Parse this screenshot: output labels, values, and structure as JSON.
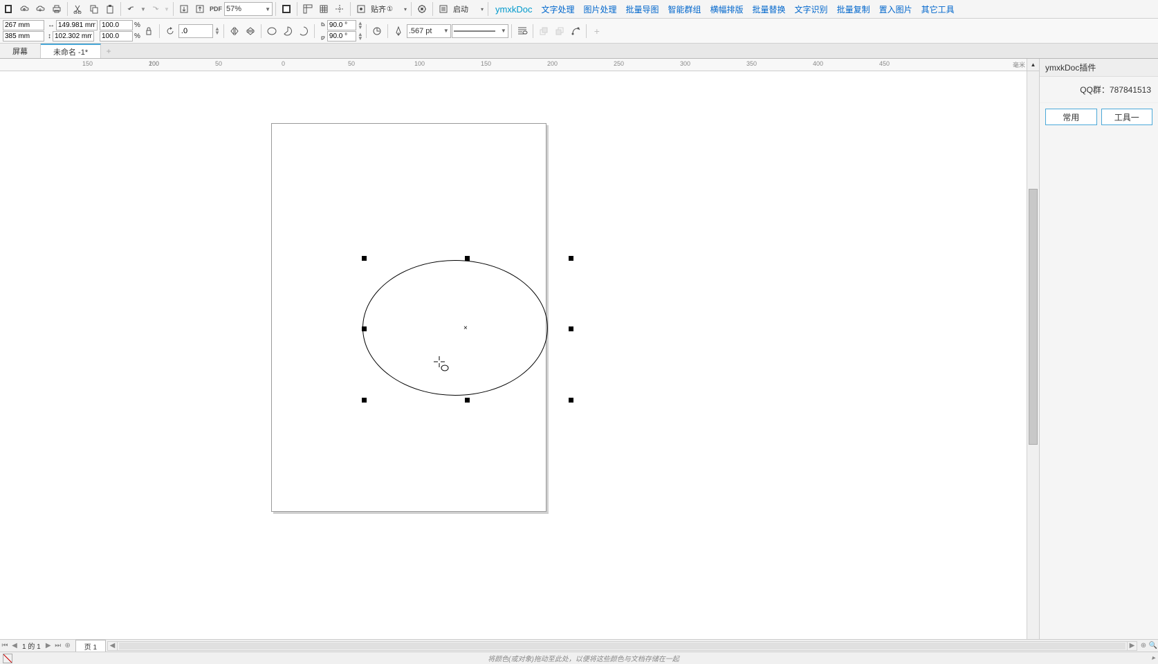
{
  "toolbar1": {
    "zoom": "57%",
    "snap_label": "贴齐",
    "snap_suffix": "①",
    "launch_label": "启动"
  },
  "menus": {
    "brand": "ymxkDoc",
    "items": [
      "文字处理",
      "图片处理",
      "批量导图",
      "智能群组",
      "横幅排版",
      "批量替换",
      "文字识别",
      "批量复制",
      "置入图片",
      "其它工具"
    ]
  },
  "props": {
    "x": "267 mm",
    "y": "385 mm",
    "w": "149.981 mm",
    "h": "102.302 mm",
    "sx": "100.0",
    "sy": "100.0",
    "pct": "%",
    "rot": ".0",
    "arc1": "90.0 °",
    "arc2": "90.0 °",
    "outline": ".567 pt"
  },
  "tabs": {
    "t1": "屏幕",
    "t2": "未命名 -1*"
  },
  "ruler": {
    "ticks": [
      "200",
      "150",
      "100",
      "50",
      "0",
      "50",
      "100",
      "150",
      "200",
      "250",
      "300",
      "350",
      "400",
      "450"
    ],
    "unit": "毫米"
  },
  "panel": {
    "title": "ymxkDoc插件",
    "qq": "QQ群：787841513",
    "btn1": "常用",
    "btn2": "工具一"
  },
  "pagenav": {
    "info": "1 的 1",
    "page_tab": "页 1"
  },
  "status": {
    "hint": "将颜色(或对象)拖动至此处，以便将这些颜色与文档存储在一起"
  }
}
